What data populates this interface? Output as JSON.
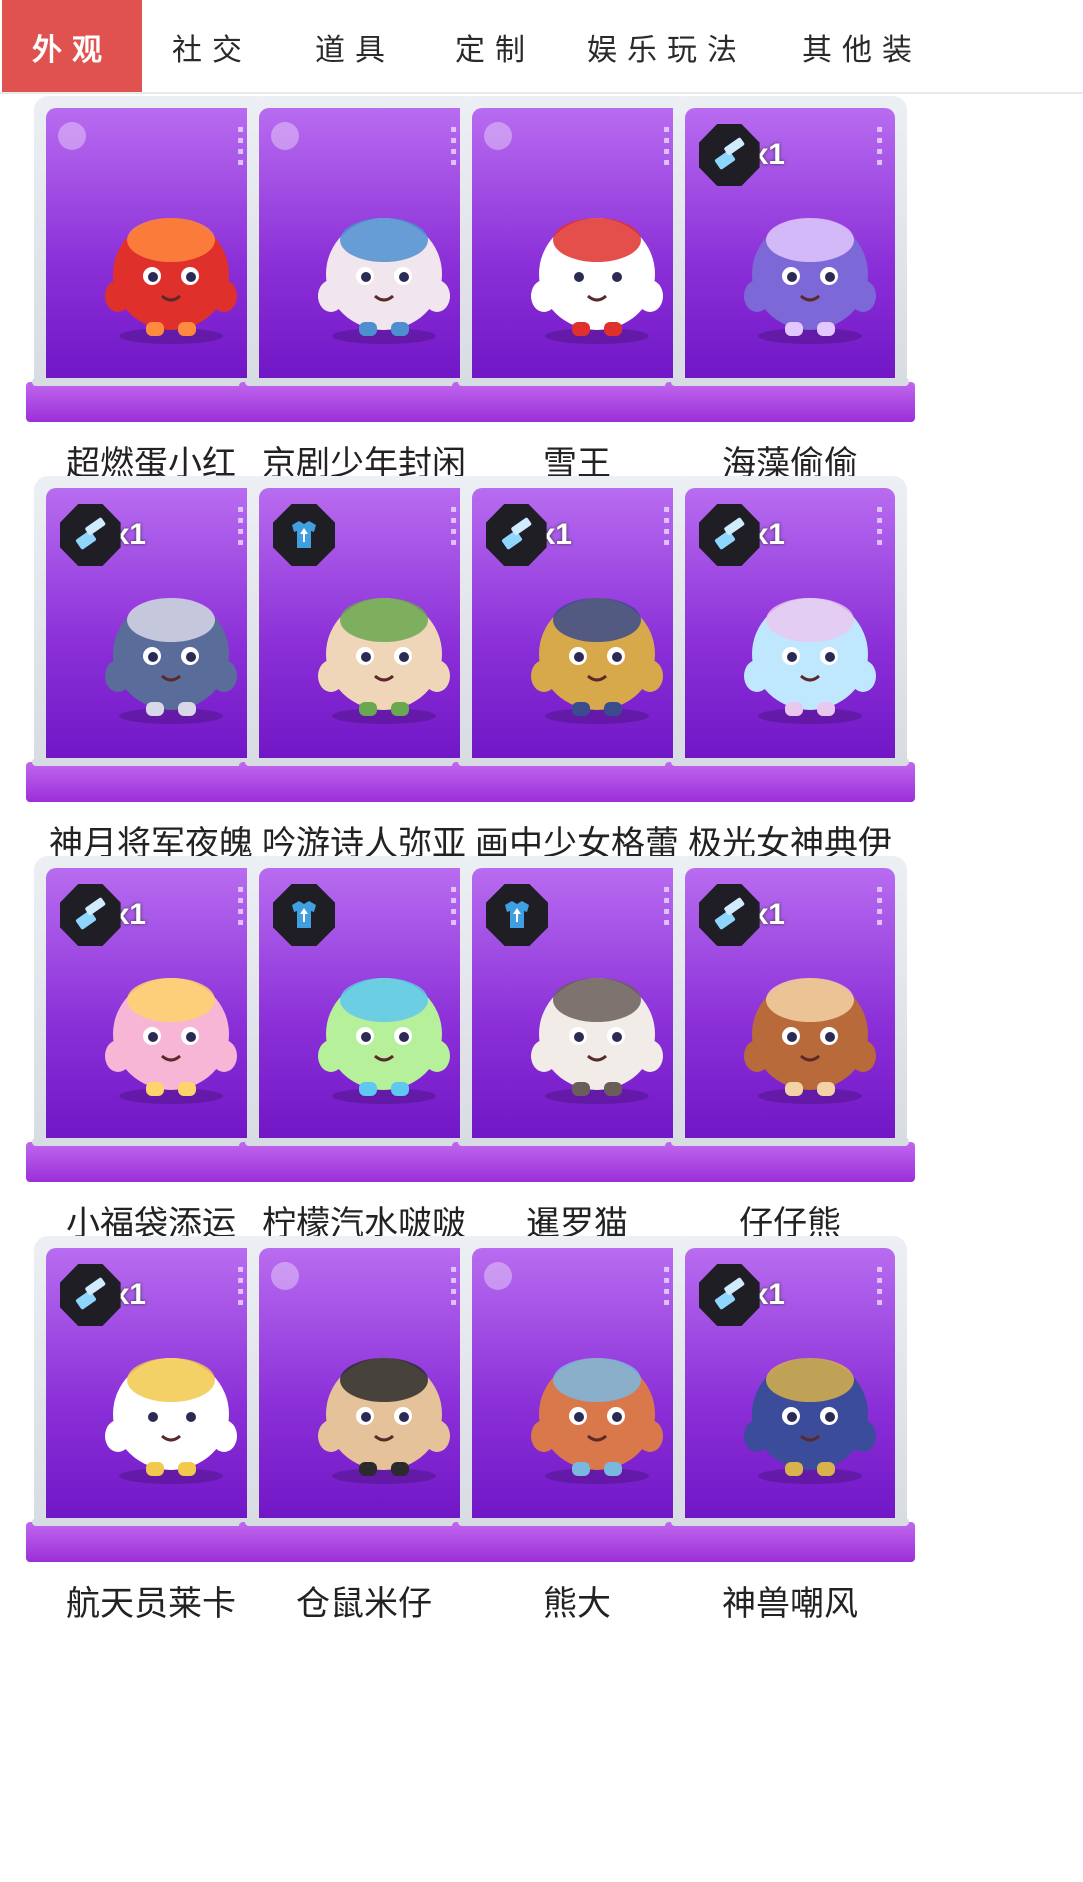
{
  "tabs": [
    {
      "label": "外观",
      "active": true
    },
    {
      "label": "社交",
      "active": false
    },
    {
      "label": "道具",
      "active": false
    },
    {
      "label": "定制",
      "active": false
    },
    {
      "label": "娱乐玩法",
      "active": false
    },
    {
      "label": "其他装",
      "active": false
    }
  ],
  "colors": {
    "tab_active_bg": "#e0524f",
    "card_purple": "#8b30d8",
    "badge_dark": "#1e1e24"
  },
  "items": [
    {
      "name": "超燃蛋小红",
      "badge": null,
      "icon": "robot-figure",
      "body": "#e0302b",
      "accent": "#ff8a3d"
    },
    {
      "name": "京剧少年封闲",
      "badge": null,
      "icon": "opera-figure",
      "body": "#f2e6ee",
      "accent": "#4e8fd0"
    },
    {
      "name": "雪王",
      "badge": null,
      "icon": "snowman-figure",
      "body": "#ffffff",
      "accent": "#e0302b"
    },
    {
      "name": "海藻偷偷",
      "badge": {
        "type": "brush-icon",
        "qty": "x1"
      },
      "icon": "fluffy-figure",
      "body": "#7d68d8",
      "accent": "#e3c8ff"
    },
    {
      "name": "神月将军夜魄",
      "badge": {
        "type": "brush-icon",
        "qty": "x1"
      },
      "icon": "general-figure",
      "body": "#596c9a",
      "accent": "#d8d8e8"
    },
    {
      "name": "吟游诗人弥亚",
      "badge": {
        "type": "shirt-icon",
        "qty": ""
      },
      "icon": "bard-figure",
      "body": "#f0d6b8",
      "accent": "#6aa84f"
    },
    {
      "name": "画中少女格蕾",
      "badge": {
        "type": "brush-icon",
        "qty": "x1"
      },
      "icon": "painting-girl-figure",
      "body": "#d8a94a",
      "accent": "#3b4c8c"
    },
    {
      "name": "极光女神典伊",
      "badge": {
        "type": "brush-icon",
        "qty": "x1"
      },
      "icon": "aurora-figure",
      "body": "#bfe8ff",
      "accent": "#e9c8f0"
    },
    {
      "name": "小福袋添运",
      "badge": {
        "type": "brush-icon",
        "qty": "x1"
      },
      "icon": "lucky-bag-figure",
      "body": "#f7b6d6",
      "accent": "#ffd36b"
    },
    {
      "name": "柠檬汽水啵啵",
      "badge": {
        "type": "shirt-icon",
        "qty": ""
      },
      "icon": "lemon-soda-figure",
      "body": "#b6f09a",
      "accent": "#5ec8f0"
    },
    {
      "name": "暹罗猫",
      "badge": {
        "type": "shirt-icon",
        "qty": ""
      },
      "icon": "cat-figure",
      "body": "#f1ece8",
      "accent": "#6b5e5a"
    },
    {
      "name": "仔仔熊",
      "badge": {
        "type": "brush-icon",
        "qty": "x1"
      },
      "icon": "bear-figure",
      "body": "#b86a3a",
      "accent": "#f3d2a6"
    },
    {
      "name": "航天员莱卡",
      "badge": {
        "type": "brush-icon",
        "qty": "x1"
      },
      "icon": "astronaut-dog-figure",
      "body": "#ffffff",
      "accent": "#f2c94c"
    },
    {
      "name": "仓鼠米仔",
      "badge": null,
      "icon": "hamster-figure",
      "body": "#e6c29a",
      "accent": "#2b2b2b"
    },
    {
      "name": "熊大",
      "badge": null,
      "icon": "brown-bear-figure",
      "body": "#d9784a",
      "accent": "#7ab8e0"
    },
    {
      "name": "神兽嘲风",
      "badge": {
        "type": "brush-icon",
        "qty": "x1"
      },
      "icon": "beast-figure",
      "body": "#3b4c9a",
      "accent": "#d8b24a"
    }
  ]
}
